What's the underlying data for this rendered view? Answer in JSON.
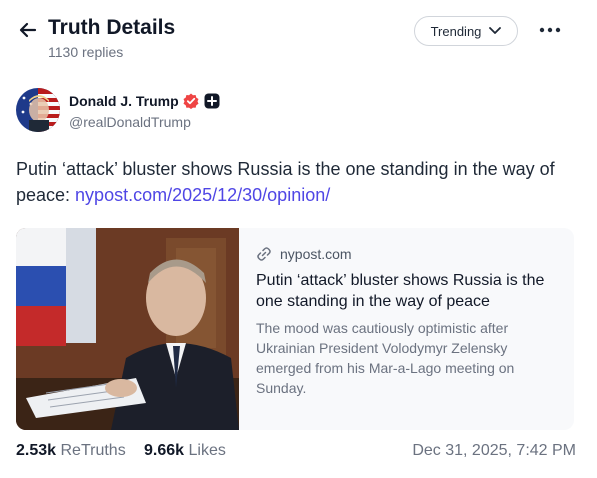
{
  "header": {
    "title": "Truth Details",
    "subtitle": "1130 replies",
    "back_icon": "arrow-left-icon",
    "trending_label": "Trending",
    "more_icon": "more-horizontal-icon"
  },
  "author": {
    "name": "Donald J. Trump",
    "handle": "@realDonaldTrump",
    "verified_color": "#ef4444"
  },
  "post": {
    "text": "Putin ‘attack’ bluster shows Russia is the one standing in the way of peace: ",
    "link_text": "nypost.com/2025/12/30/opinion/"
  },
  "card": {
    "domain": "nypost.com",
    "title": "Putin ‘attack’ bluster shows Russia is the one standing in the way of peace",
    "description": "The mood was cautiously optimistic after Ukrainian President Volodymyr Zelensky emerged from his Mar-a-Lago meeting on Sunday."
  },
  "stats": {
    "retruths_count": "2.53k",
    "retruths_label": "ReTruths",
    "likes_count": "9.66k",
    "likes_label": "Likes",
    "timestamp": "Dec 31, 2025, 7:42 PM"
  },
  "colors": {
    "accent_link": "#4f46e5",
    "muted_text": "#6b7280"
  }
}
